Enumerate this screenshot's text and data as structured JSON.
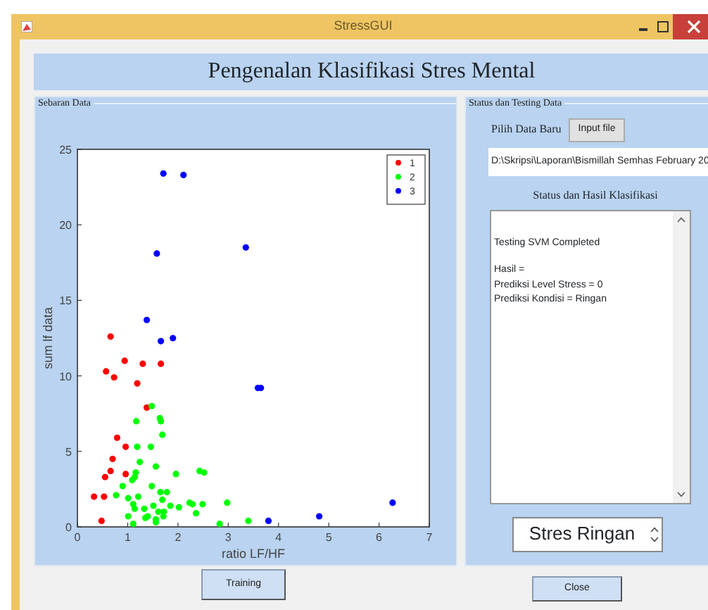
{
  "window": {
    "title": "StressGUI"
  },
  "header": {
    "title": "Pengenalan Klasifikasi Stres Mental"
  },
  "scatter_panel": {
    "title": "Sebaran Data",
    "chart_data": {
      "type": "scatter",
      "legend": true,
      "xlabel": "ratio LF/HF",
      "ylabel": "sum lf data",
      "xlim": [
        0,
        7
      ],
      "ylim": [
        0,
        25
      ],
      "xticks": [
        0,
        1,
        2,
        3,
        4,
        5,
        6,
        7
      ],
      "yticks": [
        0,
        5,
        10,
        15,
        20,
        25
      ],
      "series": [
        {
          "name": "1",
          "color": "#ff0000",
          "x": [
            0.33,
            0.53,
            0.48,
            0.55,
            0.66,
            0.7,
            0.96,
            0.79,
            0.96,
            0.66,
            0.57,
            0.73,
            0.94,
            1.3,
            1.66,
            1.19,
            1.38
          ],
          "values": [
            2.0,
            2.0,
            0.4,
            3.3,
            3.7,
            4.5,
            5.3,
            5.9,
            3.5,
            12.6,
            10.3,
            9.9,
            11.0,
            10.8,
            10.8,
            9.5,
            7.9
          ]
        },
        {
          "name": "2",
          "color": "#00ff00",
          "x": [
            1.48,
            1.64,
            1.66,
            1.17,
            1.69,
            1.19,
            1.46,
            1.24,
            1.56,
            1.16,
            1.14,
            1.09,
            2.43,
            2.52,
            1.96,
            1.48,
            0.9,
            1.65,
            1.78,
            0.77,
            1.01,
            1.21,
            1.69,
            2.23,
            2.29,
            2.98,
            2.49,
            1.11,
            1.14,
            1.33,
            1.51,
            1.85,
            2.02,
            1.61,
            1.72,
            2.36,
            1.4,
            1.35,
            1.01,
            1.71,
            1.56,
            1.56,
            1.11,
            2.83,
            3.4
          ],
          "values": [
            8.0,
            7.2,
            7.0,
            7.0,
            6.1,
            5.3,
            5.3,
            4.3,
            4.0,
            3.6,
            3.3,
            3.1,
            3.7,
            3.6,
            3.5,
            2.7,
            2.7,
            2.3,
            2.3,
            2.1,
            1.9,
            2.0,
            1.8,
            1.6,
            1.5,
            1.6,
            1.5,
            1.5,
            1.2,
            1.2,
            1.4,
            1.4,
            1.3,
            1.0,
            1.0,
            0.9,
            0.7,
            0.6,
            0.7,
            0.7,
            0.5,
            0.3,
            0.2,
            0.2,
            0.4
          ]
        },
        {
          "name": "3",
          "color": "#0000ff",
          "x": [
            1.71,
            2.11,
            1.58,
            3.35,
            1.38,
            1.66,
            1.9,
            3.59,
            3.65,
            3.8,
            4.81,
            6.27
          ],
          "values": [
            23.4,
            23.3,
            18.1,
            18.5,
            13.7,
            12.3,
            12.5,
            9.2,
            9.2,
            0.4,
            0.7,
            1.6
          ]
        }
      ]
    }
  },
  "status_panel": {
    "title": "Status dan Testing Data",
    "file_label": "Pilih Data Baru",
    "file_button": "Input file",
    "path": "D:\\Skripsi\\Laporan\\Bismillah Semhas February 20",
    "result_title": "Status dan Hasil Klasifikasi",
    "result_paragraphs": [
      {
        "lines": [
          "Testing SVM Completed"
        ]
      },
      {
        "lines": [
          "Hasil =",
          "Prediksi Level Stress = 0",
          "Prediksi Kondisi = Ringan"
        ]
      }
    ],
    "condition": "Stres Ringan"
  },
  "buttons": [
    {
      "label": "Training",
      "kind": "training"
    },
    {
      "label": "Close",
      "kind": "close"
    }
  ]
}
